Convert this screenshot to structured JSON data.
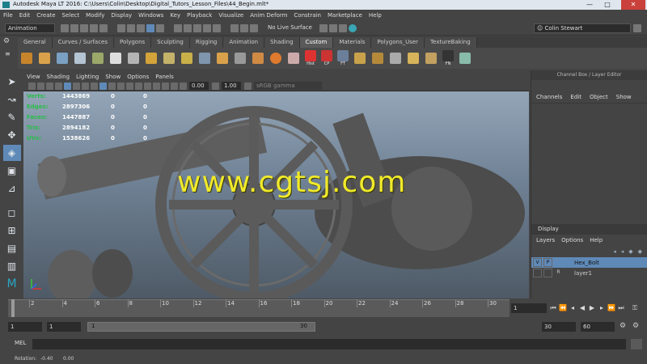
{
  "window": {
    "title": "Autodesk Maya LT 2016: C:\\Users\\Colin\\Desktop\\Digital_Tutors_Lesson_Files\\44_Begin.mlt*",
    "minimize": "—",
    "maximize": "□",
    "close": "✕"
  },
  "menubar": [
    "File",
    "Edit",
    "Create",
    "Select",
    "Modify",
    "Display",
    "Windows",
    "Key",
    "Playback",
    "Visualize",
    "Anim Deform",
    "Constrain",
    "Marketplace",
    "Help"
  ],
  "statusline": {
    "menuset": "Animation",
    "live_surface": "No Live Surface",
    "user": "Colin Stewart"
  },
  "shelf": {
    "tabs": [
      "General",
      "Curves / Surfaces",
      "Polygons",
      "Sculpting",
      "Rigging",
      "Animation",
      "Shading",
      "Custom",
      "Materials",
      "Polygons_User",
      "TextureBaking"
    ],
    "active_tab": "Custom",
    "icon_labels": [
      "Hist",
      "CP",
      "FT",
      "FN"
    ]
  },
  "viewport": {
    "menus": [
      "View",
      "Shading",
      "Lighting",
      "Show",
      "Options",
      "Panels"
    ],
    "exposure": "0.00",
    "gamma": "1.00",
    "color_space": "sRGB gamma",
    "hud": [
      {
        "label": "Verts:",
        "a": "1443869",
        "b": "0",
        "c": "0"
      },
      {
        "label": "Edges:",
        "a": "2897306",
        "b": "0",
        "c": "0"
      },
      {
        "label": "Faces:",
        "a": "1447887",
        "b": "0",
        "c": "0"
      },
      {
        "label": "Tris:",
        "a": "2894182",
        "b": "0",
        "c": "0"
      },
      {
        "label": "UVs:",
        "a": "1538626",
        "b": "0",
        "c": "0"
      }
    ],
    "watermark": "www.cgtsj.com"
  },
  "channelbox": {
    "title": "Channel Box / Layer Editor",
    "menus": [
      "Channels",
      "Edit",
      "Object",
      "Show"
    ],
    "display_tab": "Display",
    "layer_menus": [
      "Layers",
      "Options",
      "Help"
    ],
    "layers": [
      {
        "v": "V",
        "p": "P",
        "name": "Hex_Bolt",
        "selected": true
      },
      {
        "v": "",
        "p": "R",
        "name": "layer1",
        "selected": false
      }
    ]
  },
  "timeline": {
    "ticks": [
      "2",
      "4",
      "6",
      "8",
      "10",
      "12",
      "14",
      "16",
      "18",
      "20",
      "22",
      "24",
      "26",
      "28",
      "30"
    ],
    "current_frame": "1"
  },
  "range": {
    "start": "1",
    "playback_start": "1",
    "slider_start": "1",
    "slider_end": "30",
    "playback_end": "30",
    "end": "60"
  },
  "commandline": {
    "label": "MEL"
  },
  "helpline": {
    "label": "Rotation:",
    "x": "-0.40",
    "y": "0.00"
  },
  "colors": {
    "accent": "#5f8ab8",
    "watermark": "#f1ea2a",
    "selected_layer": "#5f8ab8"
  }
}
